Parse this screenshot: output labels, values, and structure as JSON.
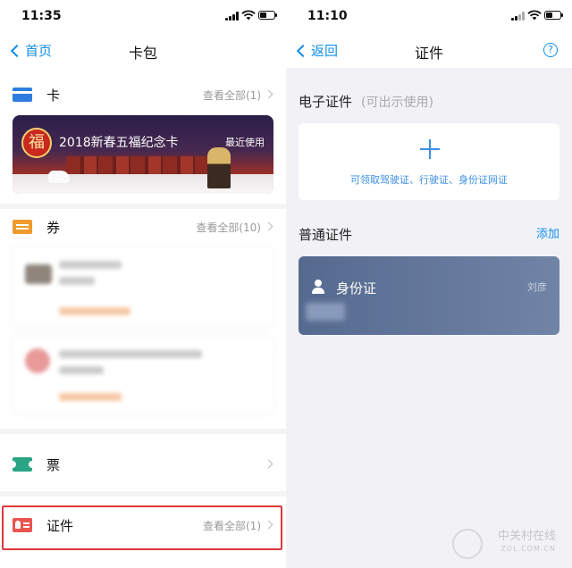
{
  "left": {
    "status": {
      "time": "11:35"
    },
    "nav": {
      "back": "首页",
      "title": "卡包"
    },
    "cards": {
      "label": "卡",
      "more": "查看全部(1)"
    },
    "fu_card": {
      "seal": "福",
      "title": "2018新春五福纪念卡",
      "recent": "最近使用"
    },
    "coupons": {
      "label": "券",
      "more": "查看全部(10)"
    },
    "tickets": {
      "label": "票"
    },
    "ids": {
      "label": "证件",
      "more": "查看全部(1)"
    }
  },
  "right": {
    "status": {
      "time": "11:10"
    },
    "nav": {
      "back": "返回",
      "title": "证件",
      "help": "?"
    },
    "electronic": {
      "label": "电子证件",
      "hint": "(可出示使用)"
    },
    "add_card": {
      "text": "可领取驾驶证、行驶证、身份证网证"
    },
    "regular": {
      "label": "普通证件",
      "add": "添加"
    },
    "id_card": {
      "label": "身份证",
      "owner": "刘彦"
    }
  },
  "watermark": {
    "text": "中关村在线",
    "sub": "ZOL.COM.CN"
  },
  "colors": {
    "accent": "#108ee9",
    "highlight": "#e1373b",
    "id_card": "#5b6f94"
  }
}
